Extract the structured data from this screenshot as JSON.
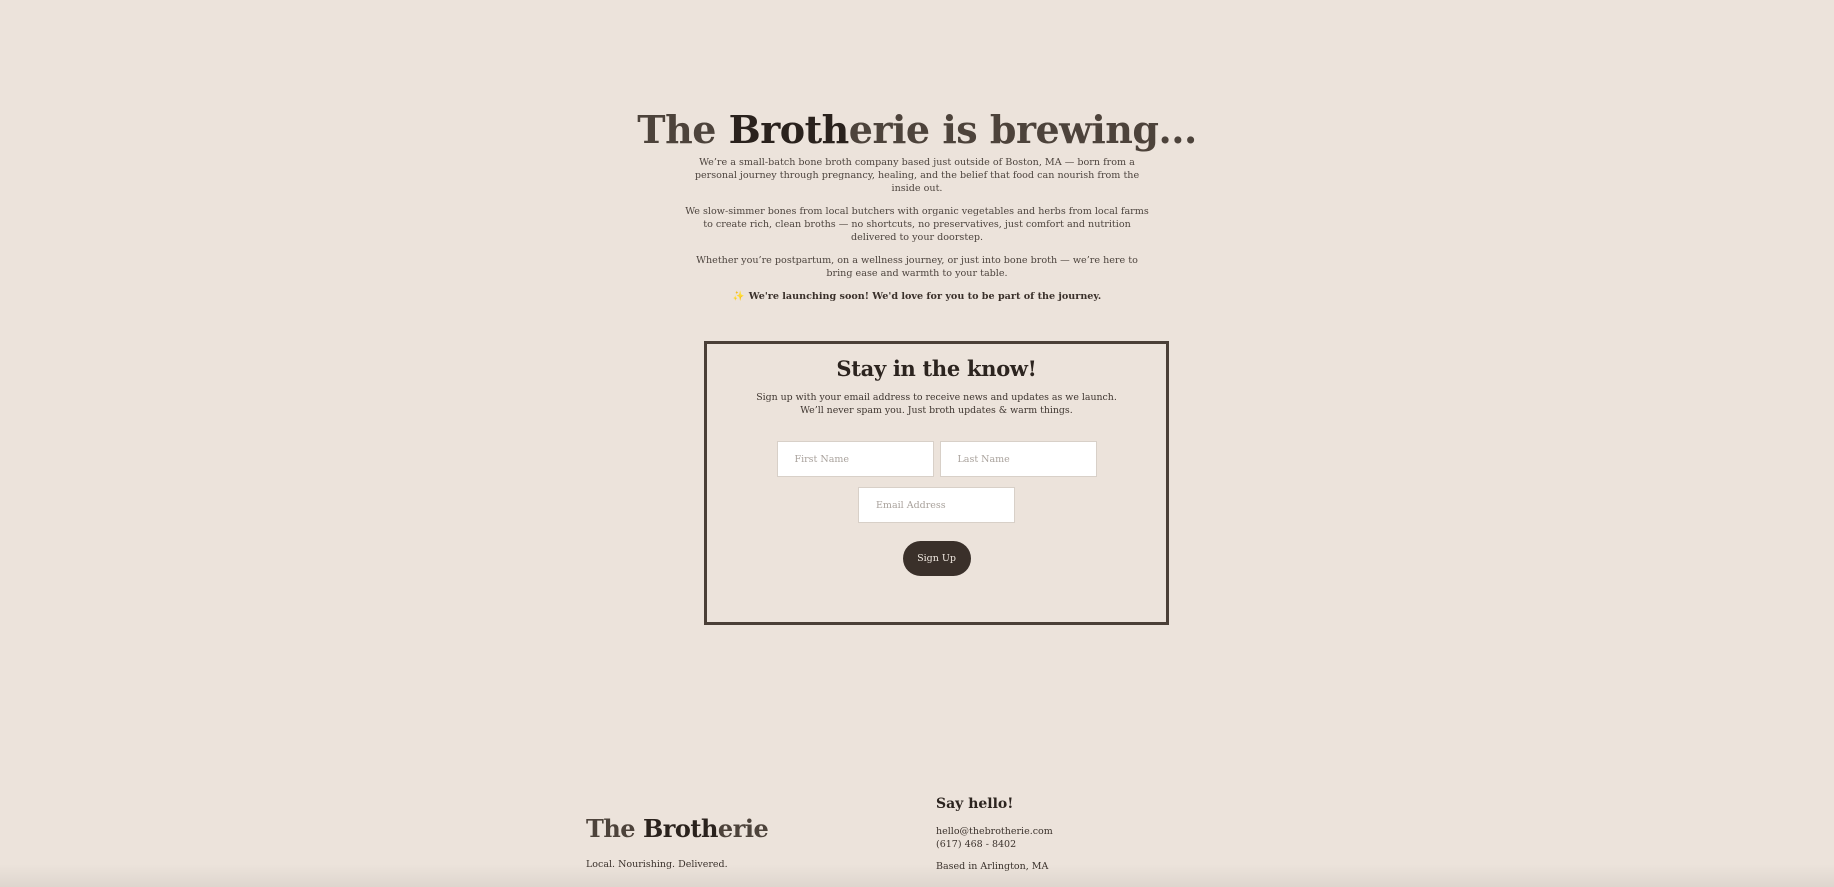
{
  "hero": {
    "title_a": "The ",
    "title_b": "Broth",
    "title_c": "erie is brewing...",
    "p1": "We’re a small-batch bone broth company based just outside of Boston, MA — born from a personal journey through pregnancy, healing, and the belief that food can nourish from the inside out.",
    "p2": "We slow-simmer bones from local butchers with organic vegetables and herbs from local farms to create rich, clean broths — no shortcuts, no preservatives, just comfort and nutrition delivered to your doorstep.",
    "p3": "Whether you’re postpartum, on a wellness journey, or just into bone broth — we’re here to bring ease and warmth to your table.",
    "launch_icon": "✨",
    "launch_text": "We're launching soon!  We'd love for you to be part of the journey."
  },
  "signup": {
    "title": "Stay in the know!",
    "line1": "Sign up with your email address to receive news and updates as we launch.",
    "line2": "We’ll never spam you. Just broth updates & warm things.",
    "first_name_placeholder": "First Name",
    "last_name_placeholder": "Last Name",
    "email_placeholder": "Email Address",
    "button_label": "Sign Up"
  },
  "footer": {
    "brand_a": "The ",
    "brand_b": "Broth",
    "brand_c": "erie",
    "tagline": "Local. Nourishing. Delivered.",
    "contact_title": "Say hello!",
    "email": "hello@thebrotherie.com",
    "phone": "(617)  468 - 8402",
    "location": "Based in Arlington, MA"
  },
  "colors": {
    "background": "#ece3db",
    "text_dark": "#2a221d",
    "text_brown": "#4d433b",
    "button": "#3a302a",
    "accent_sparkle": "#e0b24a"
  }
}
